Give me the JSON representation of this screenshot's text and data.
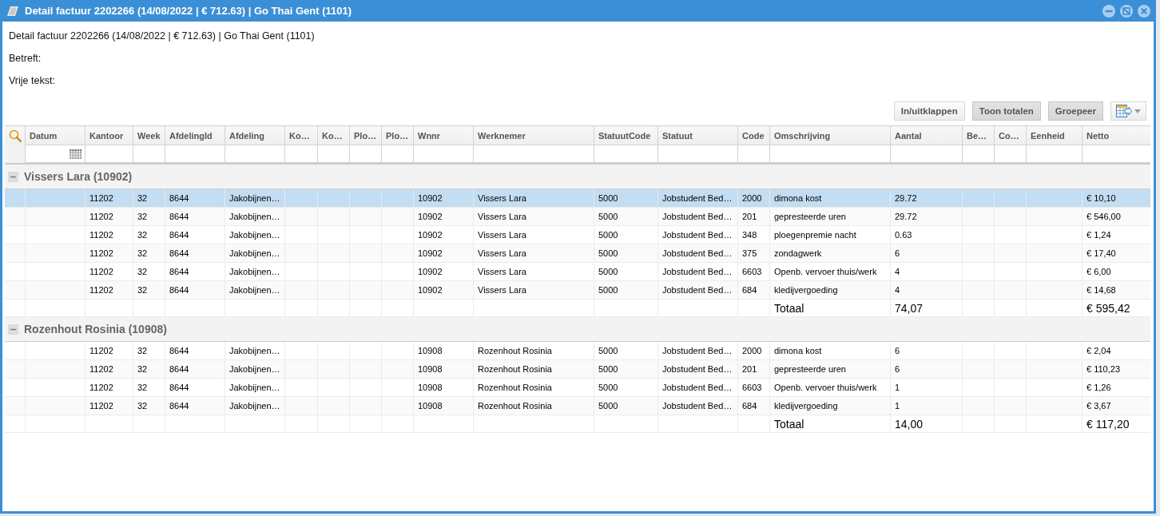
{
  "window": {
    "title": "Detail factuur 2202266 (14/08/2022 | € 712.63) | Go Thai Gent (1101)"
  },
  "info": {
    "heading": "Detail factuur 2202266 (14/08/2022 | € 712.63) | Go Thai Gent (1101)",
    "fields": [
      {
        "label": "Betreft:"
      },
      {
        "label": "Vrije tekst:"
      }
    ]
  },
  "toolbar": {
    "buttons": [
      {
        "label": "In/uitklappen",
        "pressed": false
      },
      {
        "label": "Toon totalen",
        "pressed": true
      },
      {
        "label": "Groepeer",
        "pressed": true
      }
    ]
  },
  "table": {
    "columns": [
      {
        "label": "Datum",
        "kind": "date"
      },
      {
        "label": "Kantoor",
        "kind": "text"
      },
      {
        "label": "Week",
        "kind": "text"
      },
      {
        "label": "AfdelingId",
        "kind": "text"
      },
      {
        "label": "Afdeling",
        "kind": "text"
      },
      {
        "label": "Ko…",
        "kind": "text"
      },
      {
        "label": "Ko…",
        "kind": "text"
      },
      {
        "label": "Plo…",
        "kind": "text"
      },
      {
        "label": "Plo…",
        "kind": "text"
      },
      {
        "label": "Wnnr",
        "kind": "text"
      },
      {
        "label": "Werknemer",
        "kind": "text"
      },
      {
        "label": "StatuutCode",
        "kind": "text"
      },
      {
        "label": "Statuut",
        "kind": "text"
      },
      {
        "label": "Code",
        "kind": "text"
      },
      {
        "label": "Omschrijving",
        "kind": "text"
      },
      {
        "label": "Aantal",
        "kind": "text"
      },
      {
        "label": "Be…",
        "kind": "text"
      },
      {
        "label": "Co…",
        "kind": "text"
      },
      {
        "label": "Eenheid",
        "kind": "text"
      },
      {
        "label": "Netto",
        "kind": "text"
      }
    ],
    "groups": [
      {
        "label": "Vissers Lara (10902)",
        "expanded": true,
        "rows": [
          {
            "selected": true,
            "cells": {
              "kantoor": "11202",
              "week": "32",
              "afdeling_id": "8644",
              "afdeling": "Jakobijnen…",
              "wnnr": "10902",
              "werknemer": "Vissers Lara",
              "statuut_code": "5000",
              "statuut": "Jobstudent Bed…",
              "code": "2000",
              "omschrijving": "dimona kost",
              "aantal": "29.72",
              "netto": "€ 10,10"
            }
          },
          {
            "selected": false,
            "cells": {
              "kantoor": "11202",
              "week": "32",
              "afdeling_id": "8644",
              "afdeling": "Jakobijnen…",
              "wnnr": "10902",
              "werknemer": "Vissers Lara",
              "statuut_code": "5000",
              "statuut": "Jobstudent Bed…",
              "code": "201",
              "omschrijving": "gepresteerde uren",
              "aantal": "29.72",
              "netto": "€ 546,00"
            }
          },
          {
            "selected": false,
            "cells": {
              "kantoor": "11202",
              "week": "32",
              "afdeling_id": "8644",
              "afdeling": "Jakobijnen…",
              "wnnr": "10902",
              "werknemer": "Vissers Lara",
              "statuut_code": "5000",
              "statuut": "Jobstudent Bed…",
              "code": "348",
              "omschrijving": "ploegenpremie nacht",
              "aantal": "0.63",
              "netto": "€ 1,24"
            }
          },
          {
            "selected": false,
            "cells": {
              "kantoor": "11202",
              "week": "32",
              "afdeling_id": "8644",
              "afdeling": "Jakobijnen…",
              "wnnr": "10902",
              "werknemer": "Vissers Lara",
              "statuut_code": "5000",
              "statuut": "Jobstudent Bed…",
              "code": "375",
              "omschrijving": "zondagwerk",
              "aantal": "6",
              "netto": "€ 17,40"
            }
          },
          {
            "selected": false,
            "cells": {
              "kantoor": "11202",
              "week": "32",
              "afdeling_id": "8644",
              "afdeling": "Jakobijnen…",
              "wnnr": "10902",
              "werknemer": "Vissers Lara",
              "statuut_code": "5000",
              "statuut": "Jobstudent Bed…",
              "code": "6603",
              "omschrijving": "Openb. vervoer thuis/werk",
              "aantal": "4",
              "netto": "€ 6,00"
            }
          },
          {
            "selected": false,
            "cells": {
              "kantoor": "11202",
              "week": "32",
              "afdeling_id": "8644",
              "afdeling": "Jakobijnen…",
              "wnnr": "10902",
              "werknemer": "Vissers Lara",
              "statuut_code": "5000",
              "statuut": "Jobstudent Bed…",
              "code": "684",
              "omschrijving": "kledijvergoeding",
              "aantal": "4",
              "netto": "€ 14,68"
            }
          }
        ],
        "total": {
          "omschrijving": "Totaal",
          "aantal": "74,07",
          "netto": "€ 595,42"
        }
      },
      {
        "label": "Rozenhout Rosinia (10908)",
        "expanded": true,
        "rows": [
          {
            "selected": false,
            "cells": {
              "kantoor": "11202",
              "week": "32",
              "afdeling_id": "8644",
              "afdeling": "Jakobijnen…",
              "wnnr": "10908",
              "werknemer": "Rozenhout Rosinia",
              "statuut_code": "5000",
              "statuut": "Jobstudent Bed…",
              "code": "2000",
              "omschrijving": "dimona kost",
              "aantal": "6",
              "netto": "€ 2,04"
            }
          },
          {
            "selected": false,
            "cells": {
              "kantoor": "11202",
              "week": "32",
              "afdeling_id": "8644",
              "afdeling": "Jakobijnen…",
              "wnnr": "10908",
              "werknemer": "Rozenhout Rosinia",
              "statuut_code": "5000",
              "statuut": "Jobstudent Bed…",
              "code": "201",
              "omschrijving": "gepresteerde uren",
              "aantal": "6",
              "netto": "€ 110,23"
            }
          },
          {
            "selected": false,
            "cells": {
              "kantoor": "11202",
              "week": "32",
              "afdeling_id": "8644",
              "afdeling": "Jakobijnen…",
              "wnnr": "10908",
              "werknemer": "Rozenhout Rosinia",
              "statuut_code": "5000",
              "statuut": "Jobstudent Bed…",
              "code": "6603",
              "omschrijving": "Openb. vervoer thuis/werk",
              "aantal": "1",
              "netto": "€ 1,26"
            }
          },
          {
            "selected": false,
            "cells": {
              "kantoor": "11202",
              "week": "32",
              "afdeling_id": "8644",
              "afdeling": "Jakobijnen…",
              "wnnr": "10908",
              "werknemer": "Rozenhout Rosinia",
              "statuut_code": "5000",
              "statuut": "Jobstudent Bed…",
              "code": "684",
              "omschrijving": "kledijvergoeding",
              "aantal": "1",
              "netto": "€ 3,67"
            }
          }
        ],
        "total": {
          "omschrijving": "Totaal",
          "aantal": "14,00",
          "netto": "€ 117,20"
        }
      }
    ]
  }
}
